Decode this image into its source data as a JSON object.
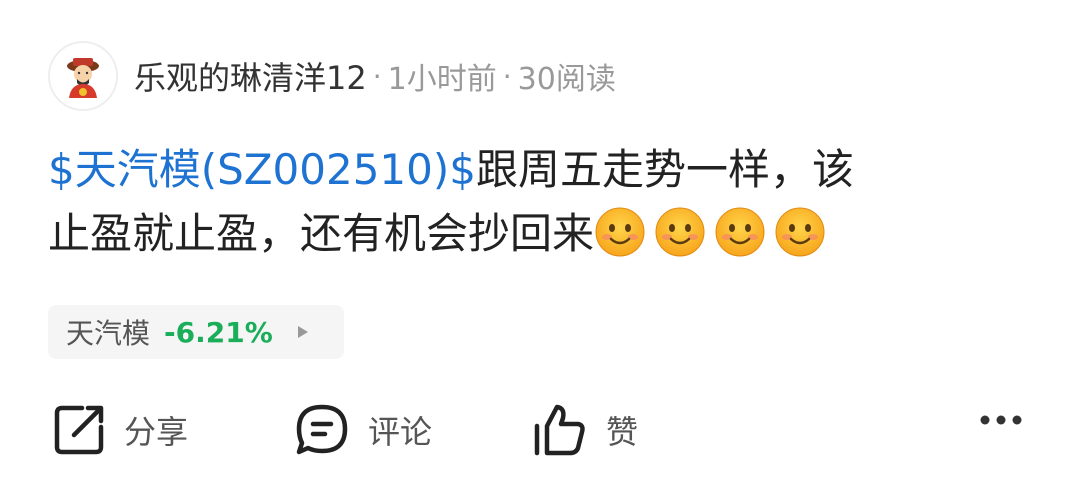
{
  "post": {
    "author": "乐观的琳清洋12",
    "separator": "·",
    "time_ago": "1小时前",
    "read_count": "30阅读",
    "stock_link": "$天汽模(SZ002510)$",
    "text_line1": "跟周五走势一样，该",
    "text_line2": "止盈就止盈，还有机会抄回来",
    "emojis": [
      "smile-emoji",
      "smile-emoji",
      "smile-emoji",
      "smile-emoji"
    ]
  },
  "stock_chip": {
    "name": "天汽模",
    "change": "-6.21%",
    "arrow_icon": "play-arrow-icon"
  },
  "actions": {
    "share": {
      "label": "分享",
      "icon": "share-icon"
    },
    "comment": {
      "label": "评论",
      "icon": "comment-icon"
    },
    "like": {
      "label": "赞",
      "icon": "thumbs-up-icon"
    },
    "more_icon": "more-dots-icon"
  },
  "colors": {
    "link": "#1e73d2",
    "change_green": "#1aad5a",
    "muted": "#999999"
  }
}
